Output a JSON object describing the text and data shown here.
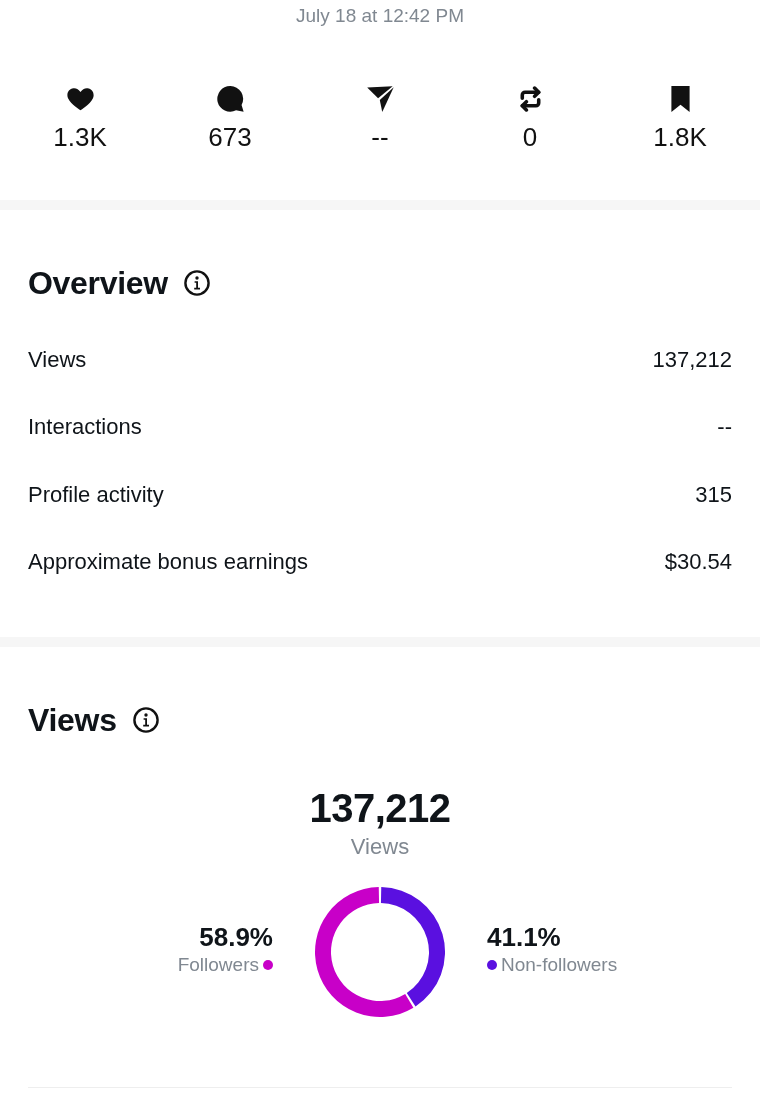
{
  "timestamp": "July 18 at 12:42 PM",
  "stats": [
    {
      "kind": "likes",
      "value": "1.3K"
    },
    {
      "kind": "replies",
      "value": "673"
    },
    {
      "kind": "shares",
      "value": "--"
    },
    {
      "kind": "reposts",
      "value": "0"
    },
    {
      "kind": "bookmarks",
      "value": "1.8K"
    }
  ],
  "overview": {
    "title": "Overview",
    "rows": [
      {
        "label": "Views",
        "value": "137,212"
      },
      {
        "label": "Interactions",
        "value": "--"
      },
      {
        "label": "Profile activity",
        "value": "315"
      },
      {
        "label": "Approximate bonus earnings",
        "value": "$30.54"
      }
    ]
  },
  "views": {
    "title": "Views",
    "total": "137,212",
    "total_label": "Views",
    "chart_data": {
      "type": "donut",
      "categories": [
        "Followers",
        "Non-followers"
      ],
      "values": [
        58.9,
        41.1
      ],
      "value_labels": [
        "58.9%",
        "41.1%"
      ]
    },
    "legend": [
      {
        "color": "#c800c8"
      },
      {
        "color": "#5a10e0"
      }
    ]
  }
}
